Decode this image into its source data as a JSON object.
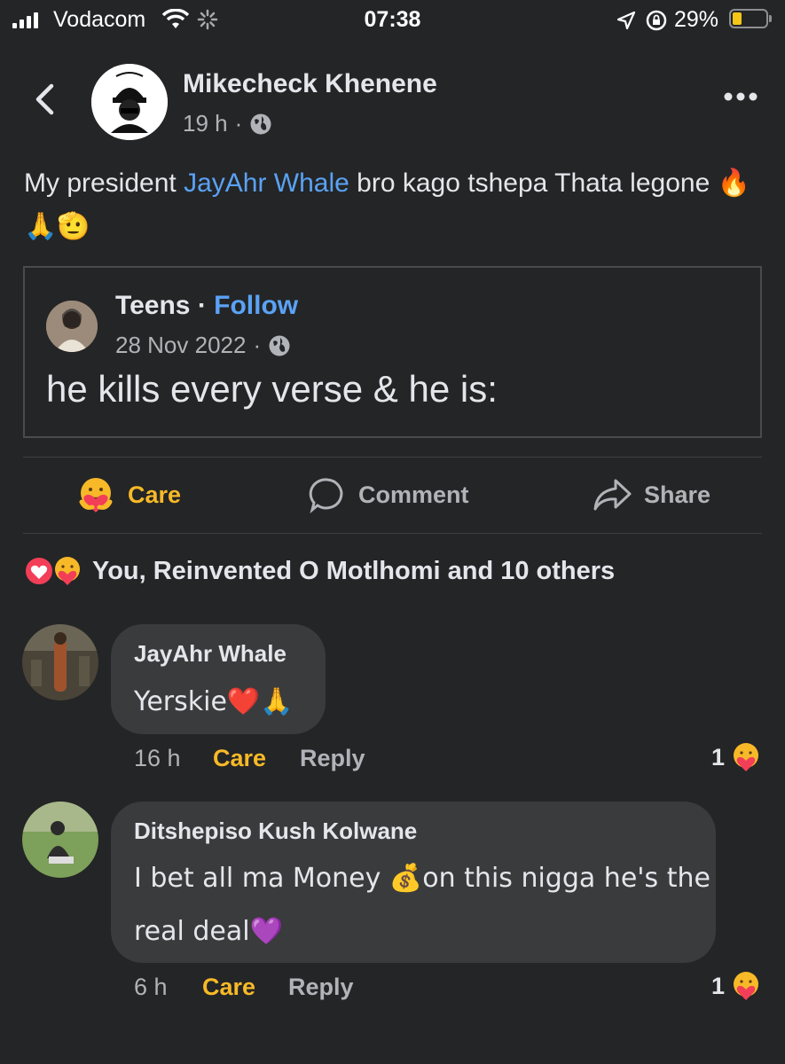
{
  "status_bar": {
    "carrier": "Vodacom",
    "time": "07:38",
    "battery_pct": "29%",
    "battery_level": 0.29
  },
  "post": {
    "author": "Mikecheck Khenene",
    "time": "19 h",
    "text_before": "My president ",
    "mention": "JayAhr Whale",
    "text_after": " bro kago tshepa Thata legone",
    "text_emoji": "🔥🙏🫡",
    "shared": {
      "page": "Teens",
      "sep": " · ",
      "follow": "Follow",
      "date": "28 Nov 2022",
      "text": "he kills every verse & he is:"
    }
  },
  "actions": {
    "care": "Care",
    "comment": "Comment",
    "share": "Share"
  },
  "reactions": {
    "summary": "You, Reinvented O Motlhomi and 10 others"
  },
  "comments": [
    {
      "name": "JayAhr Whale",
      "text": "Yerskie❤️🙏",
      "time": "16 h",
      "care": "Care",
      "reply": "Reply",
      "reactions": "1"
    },
    {
      "name": "Ditshepiso Kush Kolwane",
      "text_line1": "I bet all ma Money 💰on this nigga he's the",
      "text_line2": "real deal💜",
      "time": "6 h",
      "care": "Care",
      "reply": "Reply",
      "reactions": "1"
    }
  ],
  "colors": {
    "background": "#242526",
    "mention": "#5aa2f5",
    "care": "#f7b928",
    "bubble": "#3a3b3c"
  }
}
